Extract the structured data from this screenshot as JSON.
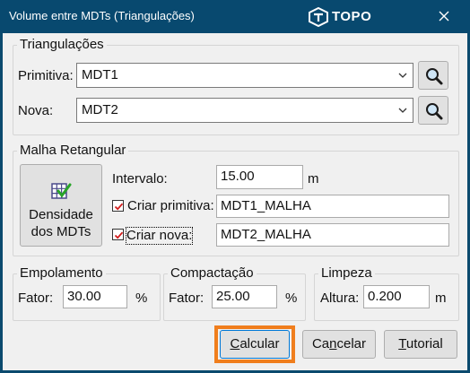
{
  "window": {
    "title": "Volume entre MDTs (Triangulações)",
    "brand": "TOPO",
    "accent": "#08496f",
    "highlight_color": "#f07e1d"
  },
  "triangulacoes": {
    "group_label": "Triangulações",
    "primitiva_label": "Primitiva:",
    "primitiva_value": "MDT1",
    "nova_label": "Nova:",
    "nova_value": "MDT2",
    "search_icon": "magnifier-icon"
  },
  "malha": {
    "group_label": "Malha Retangular",
    "density_button": {
      "line1": "Densidade",
      "line2": "dos MDTs",
      "icon": "grid-check-icon"
    },
    "intervalo_label": "Intervalo:",
    "intervalo_value": "15.00",
    "intervalo_unit": "m",
    "criar_primitiva_label": "Criar primitiva:",
    "criar_primitiva_checked": true,
    "criar_primitiva_value": "MDT1_MALHA",
    "criar_nova_label": "Criar nova:",
    "criar_nova_checked": true,
    "criar_nova_value": "MDT2_MALHA"
  },
  "empolamento": {
    "group_label": "Empolamento",
    "fator_label": "Fator:",
    "fator_value": "30.00",
    "unit": "%"
  },
  "compactacao": {
    "group_label": "Compactação",
    "fator_label": "Fator:",
    "fator_value": "25.00",
    "unit": "%"
  },
  "limpeza": {
    "group_label": "Limpeza",
    "altura_label": "Altura:",
    "altura_value": "0.200",
    "unit": "m"
  },
  "buttons": {
    "calcular_mnemonic": "C",
    "calcular_rest": "alcular",
    "cancelar_pre": "Ca",
    "cancelar_mnemonic": "n",
    "cancelar_rest": "celar",
    "tutorial_mnemonic": "T",
    "tutorial_rest": "utorial"
  }
}
